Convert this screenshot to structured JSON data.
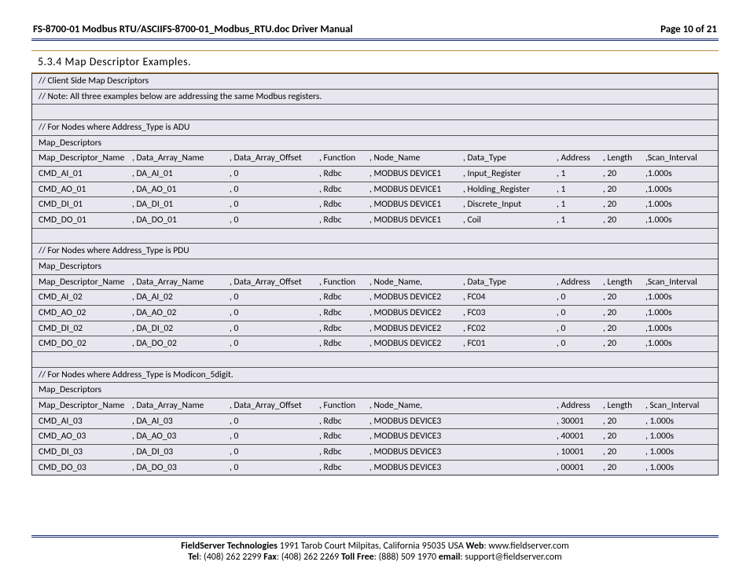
{
  "header": {
    "left": "FS-8700-01 Modbus RTU/ASCIIFS-8700-01_Modbus_RTU.doc Driver Manual",
    "right": "Page 10 of 21"
  },
  "section_title": "5.3.4   Map Descriptor Examples.",
  "comments": {
    "c1": "//   Client Side Map Descriptors",
    "c2": "// Note: All three examples below are addressing the same Modbus registers.",
    "adu_title": "// For Nodes where Address_Type is ADU",
    "pdu_title": "// For Nodes where Address_Type is PDU",
    "mod_title": "// For Nodes where Address_Type is Modicon_5digit.",
    "md_label": "Map_Descriptors"
  },
  "headers": {
    "h1": "Map_Descriptor_Name",
    "h2": ", Data_Array_Name",
    "h3": ", Data_Array_Offset",
    "h4": ", Function",
    "h5": ", Node_Name",
    "h5c": ", Node_Name,",
    "h6": ", Data_Type",
    "h7": ", Address",
    "h8": ", Length",
    "h9": ",Scan_Interval",
    "h9b": ", Scan_Interval"
  },
  "adu": [
    {
      "n": "CMD_AI_01",
      "da": ", DA_AI_01",
      "off": ", 0",
      "fn": ", Rdbc",
      "node": ", MODBUS DEVICE1",
      "dt": ", Input_Register",
      "addr": ", 1",
      "len": ", 20",
      "si": ",1.000s"
    },
    {
      "n": "CMD_AO_01",
      "da": ", DA_AO_01",
      "off": ", 0",
      "fn": ", Rdbc",
      "node": ", MODBUS DEVICE1",
      "dt": ", Holding_Register",
      "addr": ", 1",
      "len": ", 20",
      "si": ",1.000s"
    },
    {
      "n": "CMD_DI_01",
      "da": ", DA_DI_01",
      "off": ", 0",
      "fn": ", Rdbc",
      "node": ", MODBUS DEVICE1",
      "dt": ", Discrete_Input",
      "addr": ", 1",
      "len": ", 20",
      "si": ",1.000s"
    },
    {
      "n": "CMD_DO_01",
      "da": ", DA_DO_01",
      "off": ", 0",
      "fn": ", Rdbc",
      "node": ", MODBUS DEVICE1",
      "dt": ", Coil",
      "addr": ", 1",
      "len": ", 20",
      "si": ",1.000s"
    }
  ],
  "pdu": [
    {
      "n": "CMD_AI_02",
      "da": ", DA_AI_02",
      "off": ", 0",
      "fn": ", Rdbc",
      "node": ", MODBUS DEVICE2",
      "dt": ", FC04",
      "addr": ", 0",
      "len": ", 20",
      "si": ",1.000s"
    },
    {
      "n": "CMD_AO_02",
      "da": ", DA_AO_02",
      "off": ", 0",
      "fn": ", Rdbc",
      "node": ", MODBUS DEVICE2",
      "dt": ", FC03",
      "addr": ", 0",
      "len": ", 20",
      "si": ",1.000s"
    },
    {
      "n": "CMD_DI_02",
      "da": ", DA_DI_02",
      "off": ", 0",
      "fn": ", Rdbc",
      "node": ", MODBUS DEVICE2",
      "dt": ", FC02",
      "addr": ", 0",
      "len": ", 20",
      "si": ",1.000s"
    },
    {
      "n": "CMD_DO_02",
      "da": ", DA_DO_02",
      "off": ", 0",
      "fn": ", Rdbc",
      "node": ", MODBUS DEVICE2",
      "dt": ", FC01",
      "addr": ", 0",
      "len": ", 20",
      "si": ",1.000s"
    }
  ],
  "mod": [
    {
      "n": "CMD_AI_03",
      "da": ", DA_AI_03",
      "off": ", 0",
      "fn": ", Rdbc",
      "node": ", MODBUS DEVICE3",
      "dt": "",
      "addr": ", 30001",
      "len": ", 20",
      "si": ", 1.000s"
    },
    {
      "n": "CMD_AO_03",
      "da": ", DA_AO_03",
      "off": ", 0",
      "fn": ", Rdbc",
      "node": ", MODBUS DEVICE3",
      "dt": "",
      "addr": ", 40001",
      "len": ", 20",
      "si": ", 1.000s"
    },
    {
      "n": "CMD_DI_03",
      "da": ", DA_DI_03",
      "off": ", 0",
      "fn": ", Rdbc",
      "node": ", MODBUS DEVICE3",
      "dt": "",
      "addr": ", 10001",
      "len": ", 20",
      "si": ", 1.000s"
    },
    {
      "n": "CMD_DO_03",
      "da": ", DA_DO_03",
      "off": ", 0",
      "fn": ", Rdbc",
      "node": ", MODBUS DEVICE3",
      "dt": "",
      "addr": ", 00001",
      "len": ", 20",
      "si": ", 1.000s"
    }
  ],
  "footer": {
    "company": "FieldServer Technologies",
    "addr": " 1991 Tarob Court Milpitas, California 95035 USA   ",
    "web_l": "Web",
    "web_v": ": www.fieldserver.com",
    "tel_l": "Tel",
    "tel_v": ": (408) 262 2299   ",
    "fax_l": "Fax",
    "fax_v": ": (408) 262 2269   ",
    "tf_l": "Toll Free",
    "tf_v": ": (888) 509 1970   ",
    "em_l": "email",
    "em_v": ": support@fieldserver.com"
  }
}
